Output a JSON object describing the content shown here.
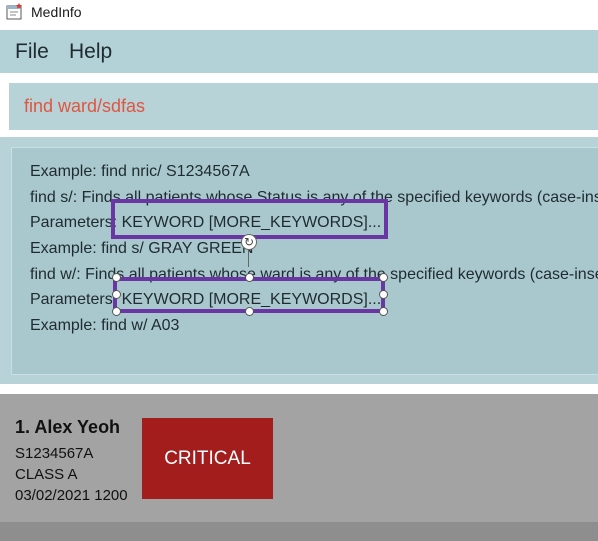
{
  "window": {
    "title": "MedInfo"
  },
  "menu": {
    "items": [
      {
        "label": "File"
      },
      {
        "label": "Help"
      }
    ]
  },
  "command": {
    "value": "find ward/sdfas"
  },
  "result": {
    "lines": [
      "Example: find nric/ S1234567A",
      "find s/: Finds all patients whose Status is any of the specified keywords (case-insensitive)",
      "Parameters: KEYWORD [MORE_KEYWORDS]...",
      "Example: find s/ GRAY GREEN",
      "find w/: Finds all patients whose ward is any of the specified keywords (case-insensitive)",
      "Parameters: KEYWORD [MORE_KEYWORDS]...",
      "Example: find w/ A03"
    ]
  },
  "patients": [
    {
      "index_name": "1.  Alex Yeoh",
      "nric": "S1234567A",
      "ward_class": "CLASS A",
      "datetime": "03/02/2021 1200",
      "status": "CRITICAL",
      "status_color": "#a31d1d"
    }
  ],
  "colors": {
    "menubar": "#b3d2d7",
    "result_bg": "#a8c8cd",
    "command_text": "#e0553f",
    "list_bg": "#a3a3a3",
    "annotation": "#6a36a3"
  },
  "icons": {
    "app": "medinfo-app-icon",
    "rotate": "rotate-handle-icon"
  }
}
